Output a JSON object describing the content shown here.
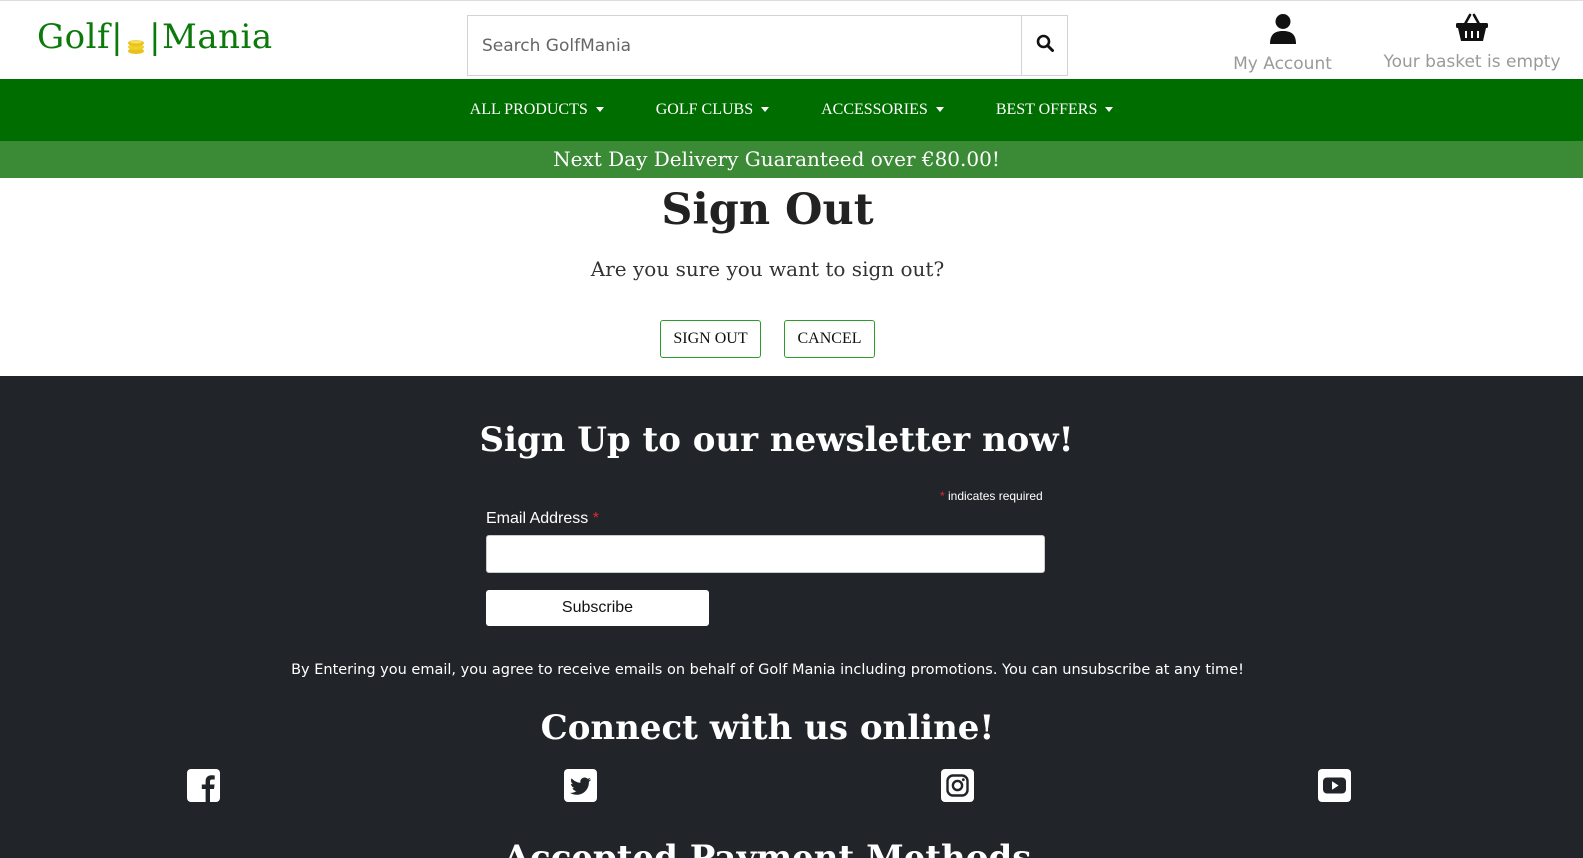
{
  "header": {
    "logo": {
      "left": "Golf",
      "right": "Mania"
    },
    "search": {
      "placeholder": "Search GolfMania"
    },
    "account": {
      "label": "My Account",
      "icon": "user-icon"
    },
    "basket": {
      "label": "Your basket is empty",
      "icon": "basket-icon"
    }
  },
  "nav": {
    "items": [
      {
        "label": "ALL PRODUCTS"
      },
      {
        "label": "GOLF CLUBS"
      },
      {
        "label": "ACCESSORIES"
      },
      {
        "label": "BEST OFFERS"
      }
    ],
    "color": "#006d00"
  },
  "banner": {
    "text": "Next Day Delivery Guaranteed over €80.00!",
    "color": "#3a8a36"
  },
  "main": {
    "title": "Sign Out",
    "question": "Are you sure you want to sign out?",
    "signout_label": "SIGN OUT",
    "cancel_label": "CANCEL"
  },
  "footer": {
    "newsletter_title": "Sign Up to our newsletter now!",
    "required_star": "*",
    "required_text": " indicates required",
    "email_label": "Email Address ",
    "email_star": "*",
    "subscribe_label": "Subscribe",
    "consent": "By Entering you email, you agree to receive emails on behalf of Golf Mania including promotions. You can unsubscribe at any time!",
    "connect_title": "Connect with us online!",
    "social": [
      {
        "icon": "facebook-icon"
      },
      {
        "icon": "twitter-icon"
      },
      {
        "icon": "instagram-icon"
      },
      {
        "icon": "youtube-icon"
      }
    ],
    "payment_title": "Accepted Payment Methods",
    "background": "#212529"
  }
}
